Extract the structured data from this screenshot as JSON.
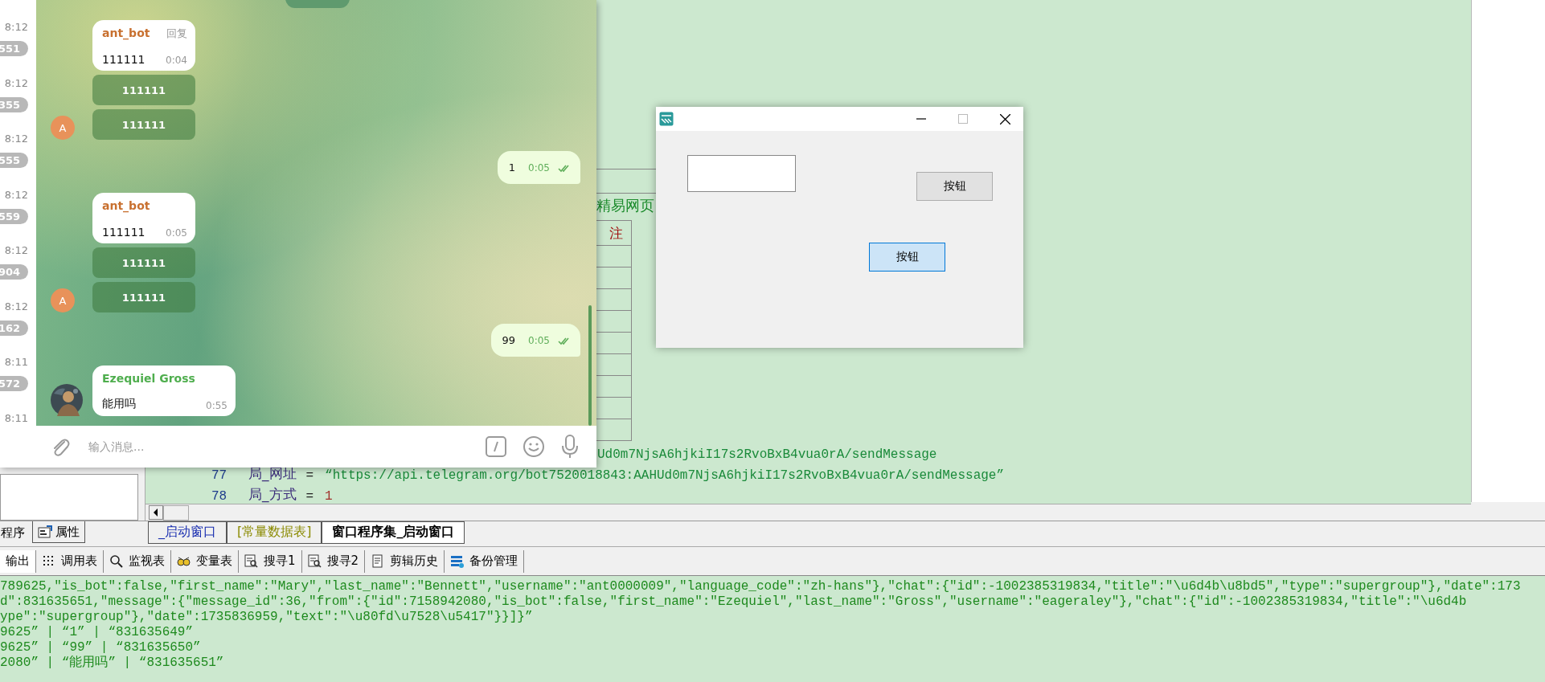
{
  "chat_list": [
    {
      "time": "8:12",
      "badge": "551"
    },
    {
      "time": "8:12",
      "badge": "355"
    },
    {
      "time": "8:12",
      "badge": "555"
    },
    {
      "time": "8:12",
      "badge": "559"
    },
    {
      "time": "8:12",
      "badge": "904"
    },
    {
      "time": "8:12",
      "badge": "162"
    },
    {
      "time": "8:11",
      "badge": "572"
    },
    {
      "time": "8:11"
    }
  ],
  "chat": {
    "messages": [
      {
        "kind": "incoming",
        "sender": "ant_bot",
        "color": "#c8702f",
        "reply_label": "回复",
        "text": "111111",
        "time": "0:04",
        "buttons": [
          "111111",
          "111111"
        ],
        "avatar": {
          "kind": "letter",
          "letter": "A"
        }
      },
      {
        "kind": "outgoing",
        "text": "1",
        "time": "0:05",
        "read": true
      },
      {
        "kind": "incoming",
        "sender": "ant_bot",
        "color": "#c8702f",
        "text": "111111",
        "time": "0:05",
        "buttons": [
          "111111",
          "111111"
        ],
        "avatar": {
          "kind": "letter",
          "letter": "A"
        }
      },
      {
        "kind": "outgoing",
        "text": "99",
        "time": "0:05",
        "read": true
      },
      {
        "kind": "incoming",
        "sender": "Ezequiel Gross",
        "color": "#4fae4e",
        "text": "能用吗",
        "time": "0:55"
      }
    ],
    "input": {
      "placeholder": "输入消息..."
    }
  },
  "editor": {
    "grid": {
      "label": "精易网页",
      "header": "注"
    },
    "lines": [
      {
        "kind": "partial",
        "code": "Ud0m7NjsA6hjkiI17s2RvoBxB4vua0rA/sendMessage"
      },
      {
        "kind": "assign",
        "number": "77",
        "name": "局_网址",
        "op": "=",
        "value": "“https://api.telegram.org/bot7520018843:AAHUd0m7NjsA6hjkiI17s2RvoBxB4vua0rA/sendMessage”",
        "color": "#1a8a3a"
      },
      {
        "kind": "assign",
        "number": "78",
        "name": "局_方式",
        "op": "=",
        "value": "1",
        "color": "#a0302a"
      }
    ]
  },
  "dialog": {
    "buttons": [
      {
        "label": "按钮",
        "focused": false
      },
      {
        "label": "按钮",
        "focused": true
      }
    ]
  },
  "left_tabs": [
    {
      "label": "程序",
      "selected": true
    },
    {
      "label": "属性",
      "selected": false
    }
  ],
  "editor_tabs": [
    {
      "label": "_启动窗口",
      "color": "#1a2fb0",
      "selected": false
    },
    {
      "label": "[常量数据表]",
      "color": "#8a8a00",
      "selected": false
    },
    {
      "label": "窗口程序集_启动窗口",
      "color": "#000000",
      "selected": true
    }
  ],
  "bottom_tabs": [
    {
      "label": "输出",
      "selected": true
    },
    {
      "label": "调用表",
      "selected": false
    },
    {
      "label": "监视表",
      "selected": false
    },
    {
      "label": "变量表",
      "selected": false
    },
    {
      "label": "搜寻1",
      "selected": false
    },
    {
      "label": "搜寻2",
      "selected": false
    },
    {
      "label": "剪辑历史",
      "selected": false
    },
    {
      "label": "备份管理",
      "selected": false
    }
  ],
  "output": {
    "lines": [
      "789625,\"is_bot\":false,\"first_name\":\"Mary\",\"last_name\":\"Bennett\",\"username\":\"ant0000009\",\"language_code\":\"zh-hans\"},\"chat\":{\"id\":-1002385319834,\"title\":\"\\u6d4b\\u8bd5\",\"type\":\"supergroup\"},\"date\":173",
      "d\":831635651,\"message\":{\"message_id\":36,\"from\":{\"id\":7158942080,\"is_bot\":false,\"first_name\":\"Ezequiel\",\"last_name\":\"Gross\",\"username\":\"eageraley\"},\"chat\":{\"id\":-1002385319834,\"title\":\"\\u6d4b",
      "ype\":\"supergroup\"},\"date\":1735836959,\"text\":\"\\u80fd\\u7528\\u5417\"}}]}”",
      "9625”  |  “1”  |  “831635649”",
      "9625”  |  “99”  |  “831635650”",
      "2080”  |  “能用吗”  |  “831635651”"
    ]
  }
}
